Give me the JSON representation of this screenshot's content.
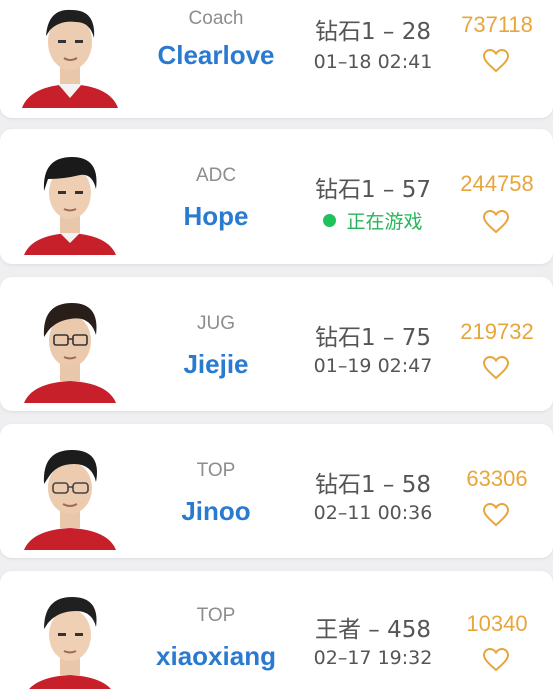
{
  "players": [
    {
      "role": "Coach",
      "name": "Clearlove",
      "rank": "钻石1 – 28",
      "last_seen": "01–18 02:41",
      "likes": "737118"
    },
    {
      "role": "ADC",
      "name": "Hope",
      "rank": "钻石1 – 57",
      "status": "正在游戏",
      "likes": "244758"
    },
    {
      "role": "JUG",
      "name": "Jiejie",
      "rank": "钻石1 – 75",
      "last_seen": "01–19 02:47",
      "likes": "219732"
    },
    {
      "role": "TOP",
      "name": "Jinoo",
      "rank": "钻石1 – 58",
      "last_seen": "02–11 00:36",
      "likes": "63306"
    },
    {
      "role": "TOP",
      "name": "xiaoxiang",
      "rank": "王者 – 458",
      "last_seen": "02–17 19:32",
      "likes": "10340"
    }
  ],
  "colors": {
    "name": "#2a7bd0",
    "likes": "#e8a53c",
    "online": "#1ec25c",
    "jersey": "#c8202a"
  },
  "icons": {
    "like": "heart-outline-icon",
    "online": "online-dot-icon"
  }
}
